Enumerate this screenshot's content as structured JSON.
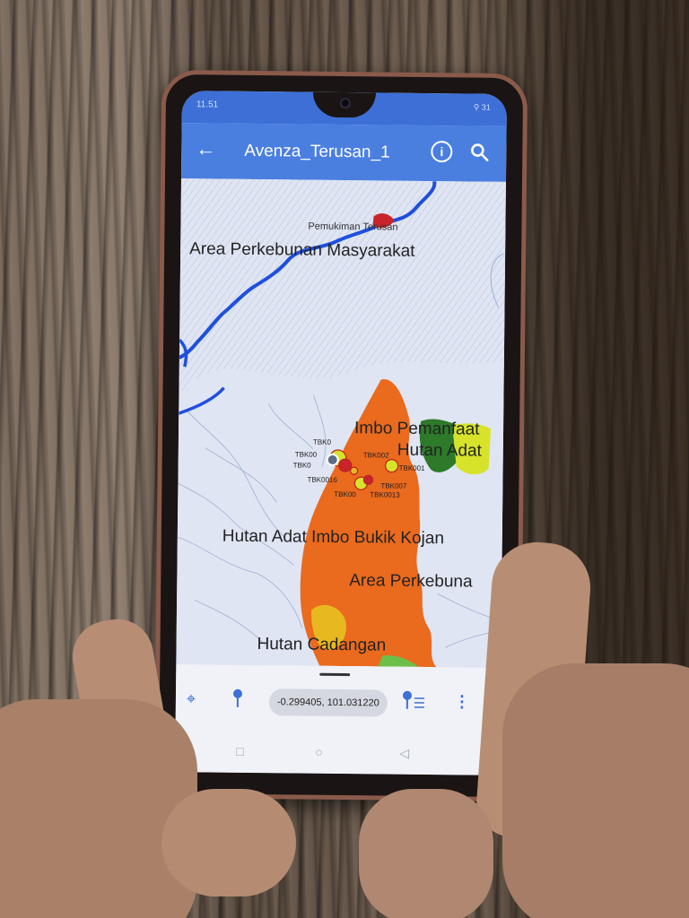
{
  "statusbar": {
    "time": "11.51",
    "indicators": "⚲ 31"
  },
  "appbar": {
    "back_icon": "arrow-left-icon",
    "title": "Avenza_Terusan_1",
    "info_icon": "info-icon",
    "search_icon": "search-icon"
  },
  "map": {
    "labels": {
      "pemukiman": "Pemukiman Terusan",
      "area_perkebunan_masyarakat": "Area Perkebunan Masyarakat",
      "imbo_pemanfaat": "Imbo Pemanfaat",
      "hutan_adat_right": "Hutan Adat",
      "hutan_adat_imbo": "Hutan Adat Imbo Bukik Kojan",
      "area_perkebuna": "Area Perkebuna",
      "hutan_cadangan": "Hutan Cadangan"
    },
    "points": {
      "p1": "TBK0",
      "p2": "TBK00",
      "p3": "TBK002",
      "p4": "TBK001",
      "p5": "TBK0016",
      "p6": "TBK007",
      "p7": "TBK00",
      "p8": "TBK0013",
      "p9": "TBK0"
    },
    "colors": {
      "river": "#1f4fe0",
      "orange": "#ea6a1e",
      "green": "#2d7a2a",
      "yellow": "#d6e32a",
      "red": "#d02020"
    }
  },
  "bottombar": {
    "coords": "-0.299405, 101.031220",
    "locate_icon": "crosshair-icon",
    "pin_icon": "pin-icon",
    "pin_list_icon": "pin-list-icon",
    "more_icon": "more-vertical-icon"
  }
}
